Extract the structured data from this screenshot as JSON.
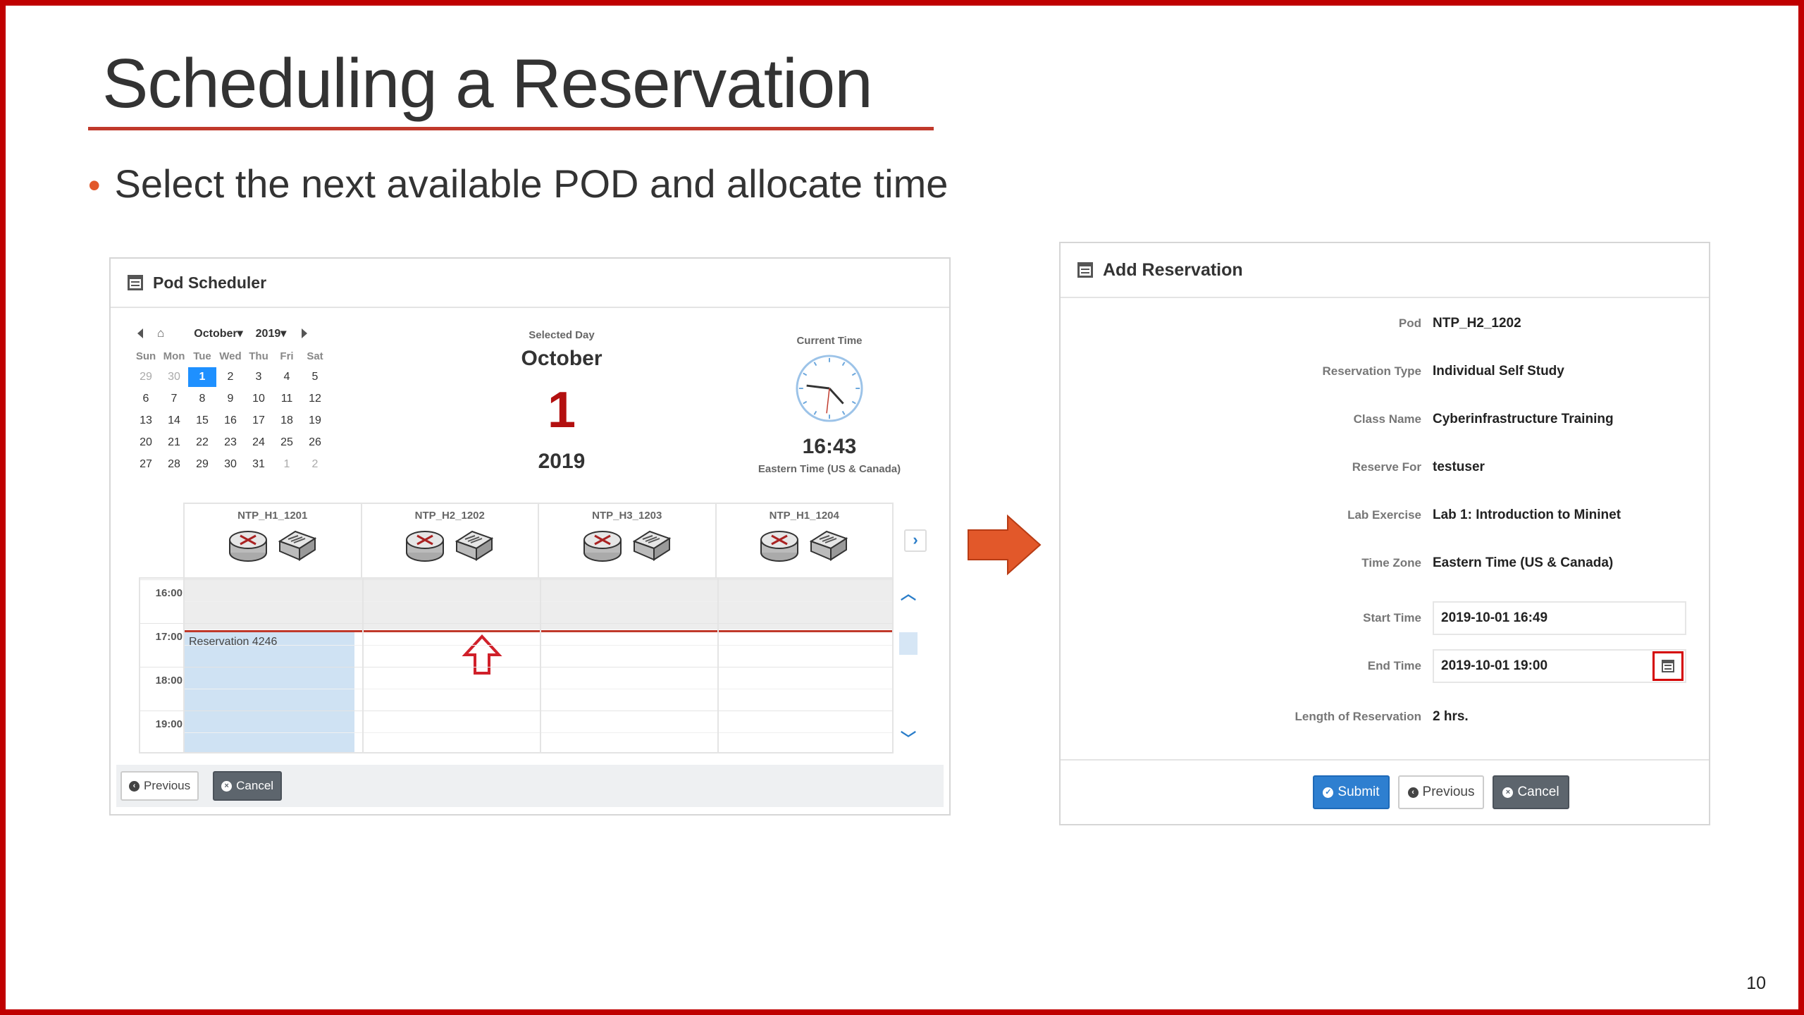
{
  "slide": {
    "title": "Scheduling a Reservation",
    "bullet": "Select the next available POD and allocate time",
    "page_number": "10",
    "colors": {
      "border": "#c00000",
      "title_rule": "#c0392b",
      "bullet_dot": "#e2582a",
      "arrow": "#e2582a"
    }
  },
  "scheduler": {
    "title": "Pod Scheduler",
    "icon": "calendar-icon",
    "mini_calendar": {
      "month": "October",
      "year": "2019",
      "weekdays": [
        "Sun",
        "Mon",
        "Tue",
        "Wed",
        "Thu",
        "Fri",
        "Sat"
      ],
      "days": [
        [
          "29",
          "30",
          "1",
          "2",
          "3",
          "4",
          "5"
        ],
        [
          "6",
          "7",
          "8",
          "9",
          "10",
          "11",
          "12"
        ],
        [
          "13",
          "14",
          "15",
          "16",
          "17",
          "18",
          "19"
        ],
        [
          "20",
          "21",
          "22",
          "23",
          "24",
          "25",
          "26"
        ],
        [
          "27",
          "28",
          "29",
          "30",
          "31",
          "1",
          "2"
        ]
      ],
      "selected_day": "1"
    },
    "selected_day": {
      "label": "Selected Day",
      "month": "October",
      "day": "1",
      "year": "2019"
    },
    "current_time": {
      "label": "Current Time",
      "time": "16:43",
      "timezone": "Eastern Time (US & Canada)"
    },
    "pods": [
      "NTP_H1_1201",
      "NTP_H2_1202",
      "NTP_H3_1203",
      "NTP_H1_1204"
    ],
    "times": [
      "16:00",
      "17:00",
      "18:00",
      "19:00"
    ],
    "reservation": "Reservation 4246",
    "buttons": {
      "previous": "Previous",
      "cancel": "Cancel"
    }
  },
  "add_reservation": {
    "title": "Add Reservation",
    "icon": "calendar-icon",
    "fields": [
      {
        "label": "Pod",
        "value": "NTP_H2_1202"
      },
      {
        "label": "Reservation Type",
        "value": "Individual Self Study"
      },
      {
        "label": "Class Name",
        "value": "Cyberinfrastructure Training"
      },
      {
        "label": "Reserve For",
        "value": "testuser"
      },
      {
        "label": "Lab Exercise",
        "value": "Lab 1: Introduction to Mininet"
      },
      {
        "label": "Time Zone",
        "value": "Eastern Time (US & Canada)"
      }
    ],
    "start_time": {
      "label": "Start Time",
      "value": "2019-10-01 16:49"
    },
    "end_time": {
      "label": "End Time",
      "value": "2019-10-01 19:00"
    },
    "length": {
      "label": "Length of Reservation",
      "value": "2 hrs."
    },
    "buttons": {
      "submit": "Submit",
      "previous": "Previous",
      "cancel": "Cancel"
    }
  }
}
